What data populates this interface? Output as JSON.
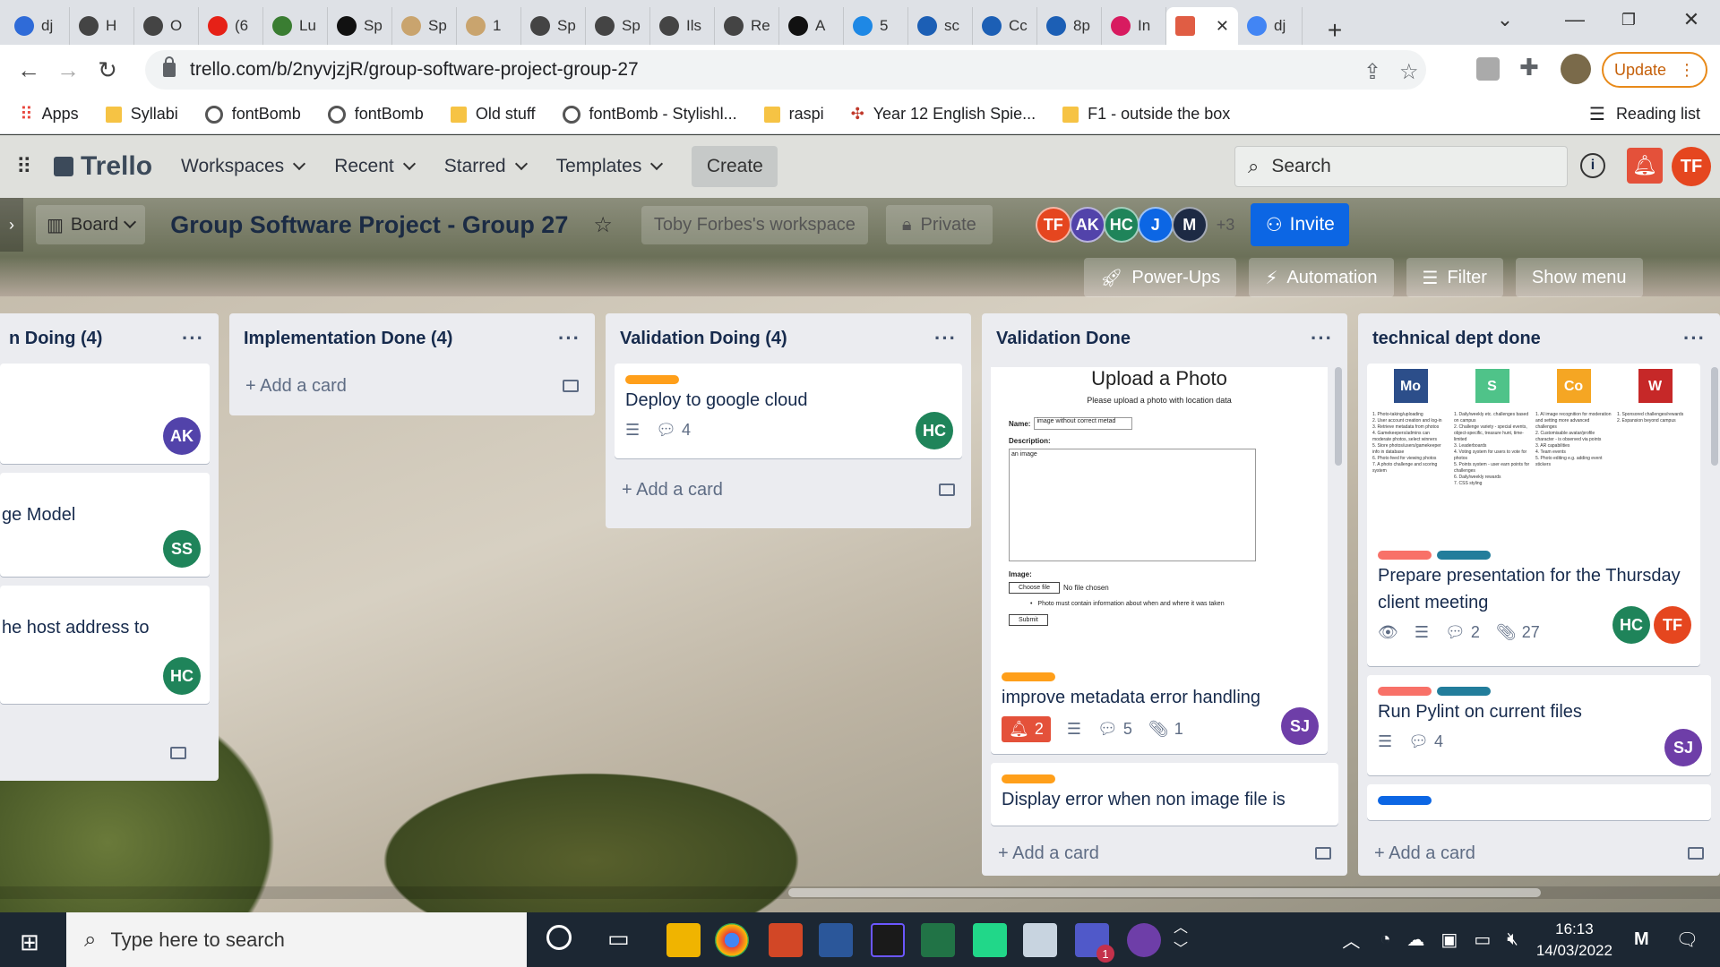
{
  "browser": {
    "tabs": [
      {
        "label": "dj",
        "color": "#2f6bd8"
      },
      {
        "label": "H",
        "color": "#444"
      },
      {
        "label": "O",
        "color": "#444"
      },
      {
        "label": "(6",
        "color": "#e62117"
      },
      {
        "label": "Lu",
        "color": "#3a7d32"
      },
      {
        "label": "Sp",
        "color": "#111"
      },
      {
        "label": "Sp",
        "color": "#c9a46e"
      },
      {
        "label": "1",
        "color": "#c9a46e"
      },
      {
        "label": "Sp",
        "color": "#444"
      },
      {
        "label": "Sp",
        "color": "#444"
      },
      {
        "label": "Ils",
        "color": "#444"
      },
      {
        "label": "Re",
        "color": "#444"
      },
      {
        "label": "A",
        "color": "#111"
      },
      {
        "label": "5",
        "color": "#1e88e5"
      },
      {
        "label": "sc",
        "color": "#1c5fb5"
      },
      {
        "label": "Cc",
        "color": "#1c5fb5"
      },
      {
        "label": "8p",
        "color": "#1c5fb5"
      },
      {
        "label": "In",
        "color": "#d81b60"
      }
    ],
    "active_tab_close": "✕",
    "last_tab": {
      "label": "dj",
      "color": "#4285f4"
    },
    "new_tab": "+",
    "url": "trello.com/b/2nyvjzjR/group-software-project-group-27",
    "update_label": "Update",
    "bookmarks": [
      {
        "label": "Apps",
        "type": "apps"
      },
      {
        "label": "Syllabi",
        "type": "folder"
      },
      {
        "label": "fontBomb",
        "type": "globe"
      },
      {
        "label": "fontBomb",
        "type": "globe"
      },
      {
        "label": "Old stuff",
        "type": "folder"
      },
      {
        "label": "fontBomb - Stylishl...",
        "type": "globe"
      },
      {
        "label": "raspi",
        "type": "folder"
      },
      {
        "label": "Year 12 English Spie...",
        "type": "pin"
      },
      {
        "label": "F1 - outside the box",
        "type": "folder"
      }
    ],
    "reading_list": "Reading list"
  },
  "trello": {
    "logo": "Trello",
    "nav": [
      "Workspaces",
      "Recent",
      "Starred",
      "Templates"
    ],
    "create": "Create",
    "search_placeholder": "Search",
    "user_initials": "TF"
  },
  "board": {
    "view": "Board",
    "title": "Group Software Project - Group 27",
    "workspace": "Toby Forbes's workspace",
    "visibility": "Private",
    "members": [
      {
        "initials": "TF",
        "color": "#e5461f"
      },
      {
        "initials": "AK",
        "color": "#5243aa"
      },
      {
        "initials": "HC",
        "color": "#1f845a"
      },
      {
        "initials": "J",
        "color": "#0c66e4"
      },
      {
        "initials": "M",
        "color": "#1d2a44"
      }
    ],
    "member_overflow": "+3",
    "invite": "Invite",
    "powerups": "Power-Ups",
    "automation": "Automation",
    "filter": "Filter",
    "show_menu": "Show menu"
  },
  "lists": {
    "impl_doing": {
      "title": "n Doing (4)",
      "cards": [
        {
          "title": "",
          "avatar": "AK",
          "color": "#5243aa"
        },
        {
          "title": "ge Model",
          "avatar": "SS",
          "color": "#1f845a"
        },
        {
          "title": "he host address to",
          "avatar": "HC",
          "color": "#1f845a"
        }
      ]
    },
    "impl_done": {
      "title": "Implementation Done (4)",
      "add": "Add a card"
    },
    "val_doing": {
      "title": "Validation Doing (4)",
      "card": {
        "title": "Deploy to google cloud",
        "comments": "4",
        "avatar": "HC",
        "label_color": "#ff9f1a"
      },
      "add": "Add a card"
    },
    "val_done": {
      "title": "Validation Done",
      "shot": {
        "heading": "Upload a Photo",
        "sub": "Please upload a photo with location data",
        "name_label": "Name:",
        "name_value": "image without correct metad",
        "desc_label": "Description:",
        "desc_value": "an image",
        "image_label": "Image:",
        "choose": "Choose file",
        "no_file": "No file chosen",
        "note": "Photo must contain information about when and where it was taken",
        "submit": "Submit"
      },
      "card1": {
        "title": "improve metadata error handling",
        "notif": "2",
        "comments": "5",
        "attachments": "1",
        "avatar": "SJ",
        "label_color": "#ff9f1a"
      },
      "card2": {
        "title": "Display error when non image file is",
        "label_color": "#ff9f1a"
      },
      "add": "Add a card"
    },
    "tech_done": {
      "title": "technical dept done",
      "grid": [
        {
          "tag": "Mo",
          "color": "#2c4e8a",
          "lines": [
            "1. Photo-taking/uploading",
            "2. User account creation and log-in",
            "3. Retrieve metadata from photos",
            "4. Gamekeepers/admins can moderate photos, select winners",
            "5. Store photos/users/gamekeeper info in database",
            "6. Photo feed for viewing photos",
            "7. A photo challenge and scoring system"
          ]
        },
        {
          "tag": "S",
          "color": "#4fc389",
          "lines": [
            "1. Daily/weekly etc. challenges based on campus",
            "2. Challenge variety - special events, object-specific, treasure hunt, time-limited",
            "3. Leaderboards",
            "4. Voting system for users to vote for photos",
            "5. Points system - user earn points for challenges",
            "6. Daily/weekly rewards",
            "7. CSS styling"
          ]
        },
        {
          "tag": "Co",
          "color": "#f5a623",
          "lines": [
            "1. AI image recognition for moderation and setting more advanced challenges",
            "2. Customisable avatar/profile character - is observed via points",
            "3. AR capabilities",
            "4. Team events",
            "5. Photo editing e.g. adding event stickers"
          ]
        },
        {
          "tag": "W",
          "color": "#c62828",
          "lines": [
            "1. Sponsored challenges/rewards",
            "2. Expansion beyond campus"
          ]
        }
      ],
      "card1": {
        "title": "Prepare presentation for the Thursday client meeting",
        "comments": "2",
        "attachments": "27",
        "avatars": [
          {
            "initials": "HC",
            "color": "#1f845a"
          },
          {
            "initials": "TF",
            "color": "#e5461f"
          }
        ],
        "labels": [
          "#f87168",
          "#227d9b"
        ]
      },
      "card2": {
        "title": "Run Pylint on current files",
        "comments": "4",
        "avatar": "SJ",
        "labels": [
          "#f87168",
          "#227d9b"
        ]
      },
      "card3": {
        "labels": [
          "#0c66e4"
        ]
      },
      "add": "Add a card"
    }
  },
  "taskbar": {
    "search_placeholder": "Type here to search",
    "time": "16:13",
    "date": "14/03/2022",
    "teams_badge": "1"
  }
}
